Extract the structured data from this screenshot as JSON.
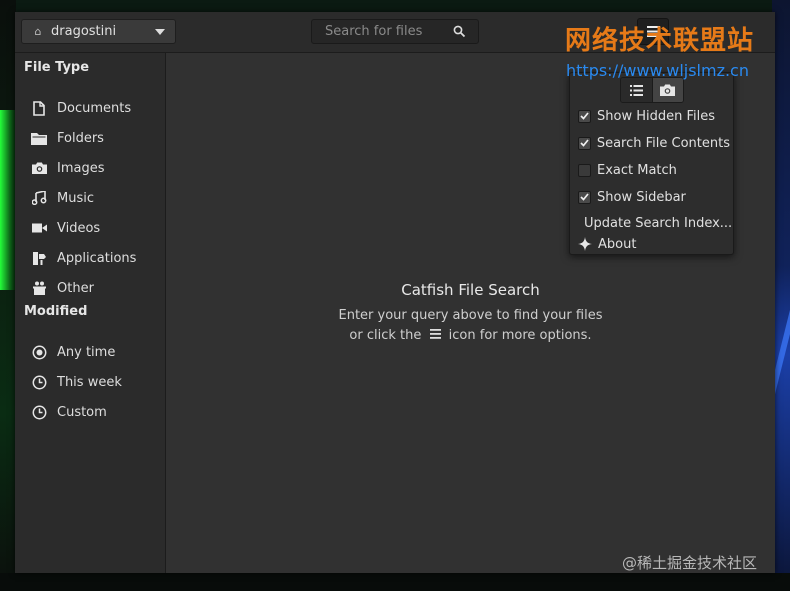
{
  "header": {
    "location_label": "dragostini",
    "search_placeholder": "Search for files"
  },
  "sidebar": {
    "file_type_title": "File Type",
    "file_types": [
      {
        "label": "Documents",
        "icon": "document-icon"
      },
      {
        "label": "Folders",
        "icon": "folder-icon"
      },
      {
        "label": "Images",
        "icon": "camera-icon"
      },
      {
        "label": "Music",
        "icon": "music-note-icon"
      },
      {
        "label": "Videos",
        "icon": "video-camera-icon"
      },
      {
        "label": "Applications",
        "icon": "applications-icon"
      },
      {
        "label": "Other",
        "icon": "other-icon"
      }
    ],
    "modified_title": "Modified",
    "modified": [
      {
        "label": "Any time",
        "icon": "radio-selected-icon",
        "selected": true
      },
      {
        "label": "This week",
        "icon": "clock-icon",
        "selected": false
      },
      {
        "label": "Custom",
        "icon": "clock-icon",
        "selected": false
      }
    ]
  },
  "main": {
    "title": "Catfish File Search",
    "line1": "Enter your query above to find your files",
    "line2_prefix": "or click the",
    "line2_suffix": "icon for more options."
  },
  "menu": {
    "options": [
      {
        "label": "Show Hidden Files",
        "checked": true
      },
      {
        "label": "Search File Contents",
        "checked": true
      },
      {
        "label": "Exact Match",
        "checked": false
      },
      {
        "label": "Show Sidebar",
        "checked": true
      }
    ],
    "update_label": "Update Search Index...",
    "about_label": "About"
  },
  "watermark": {
    "site_name": "网络技术联盟站",
    "site_url": "https://www.wljslmz.cn",
    "credit": "@稀土掘金技术社区"
  }
}
